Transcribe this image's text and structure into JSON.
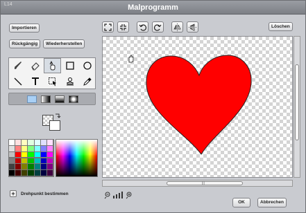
{
  "window": {
    "title": "Malprogramm",
    "peek_text": "L14"
  },
  "left_buttons": {
    "import": "Importieren",
    "undo": "Rückgängig",
    "redo": "Wiederherstellen"
  },
  "toolbar_icons": [
    "fit-icon",
    "shrink-icon",
    "rotate-left-icon",
    "rotate-right-icon",
    "flip-horizontal-icon",
    "flip-vertical-icon"
  ],
  "clear_label": "Löschen",
  "tools": [
    "brush-icon",
    "eraser-icon",
    "fill-icon",
    "rectangle-icon",
    "ellipse-icon",
    "line-icon",
    "text-icon",
    "select-icon",
    "stamp-icon",
    "eyedropper-icon"
  ],
  "active_tool": "fill-icon",
  "fill_options": [
    "solid",
    "horizontal-gradient",
    "vertical-gradient",
    "radial-gradient"
  ],
  "colors": {
    "primary": "#ff0000",
    "heart_fill": "#ff0000",
    "accent_selected_option": "#a9d0f5"
  },
  "setpoint_label": "Drehpunkt bestimmen",
  "footer": {
    "ok": "OK",
    "cancel": "Abbrechen"
  },
  "palette_colors": [
    [
      "#ffffff",
      "#ffe0e0",
      "#ffffc0",
      "#e0ffe0",
      "#e0ffff",
      "#e0e0ff",
      "#ffe0ff"
    ],
    [
      "#e0e0e0",
      "#ff8080",
      "#ffff80",
      "#80ff80",
      "#80ffff",
      "#8080ff",
      "#ff80ff"
    ],
    [
      "#c0c0c0",
      "#ff0000",
      "#ffff00",
      "#00ff00",
      "#00ffff",
      "#0000ff",
      "#ff00ff"
    ],
    [
      "#808080",
      "#c00000",
      "#c0c000",
      "#00c000",
      "#00c0c0",
      "#0000c0",
      "#c000c0"
    ],
    [
      "#404040",
      "#800000",
      "#808000",
      "#008000",
      "#008080",
      "#000080",
      "#800080"
    ],
    [
      "#000000",
      "#400000",
      "#404000",
      "#004000",
      "#004040",
      "#000040",
      "#400040"
    ]
  ]
}
